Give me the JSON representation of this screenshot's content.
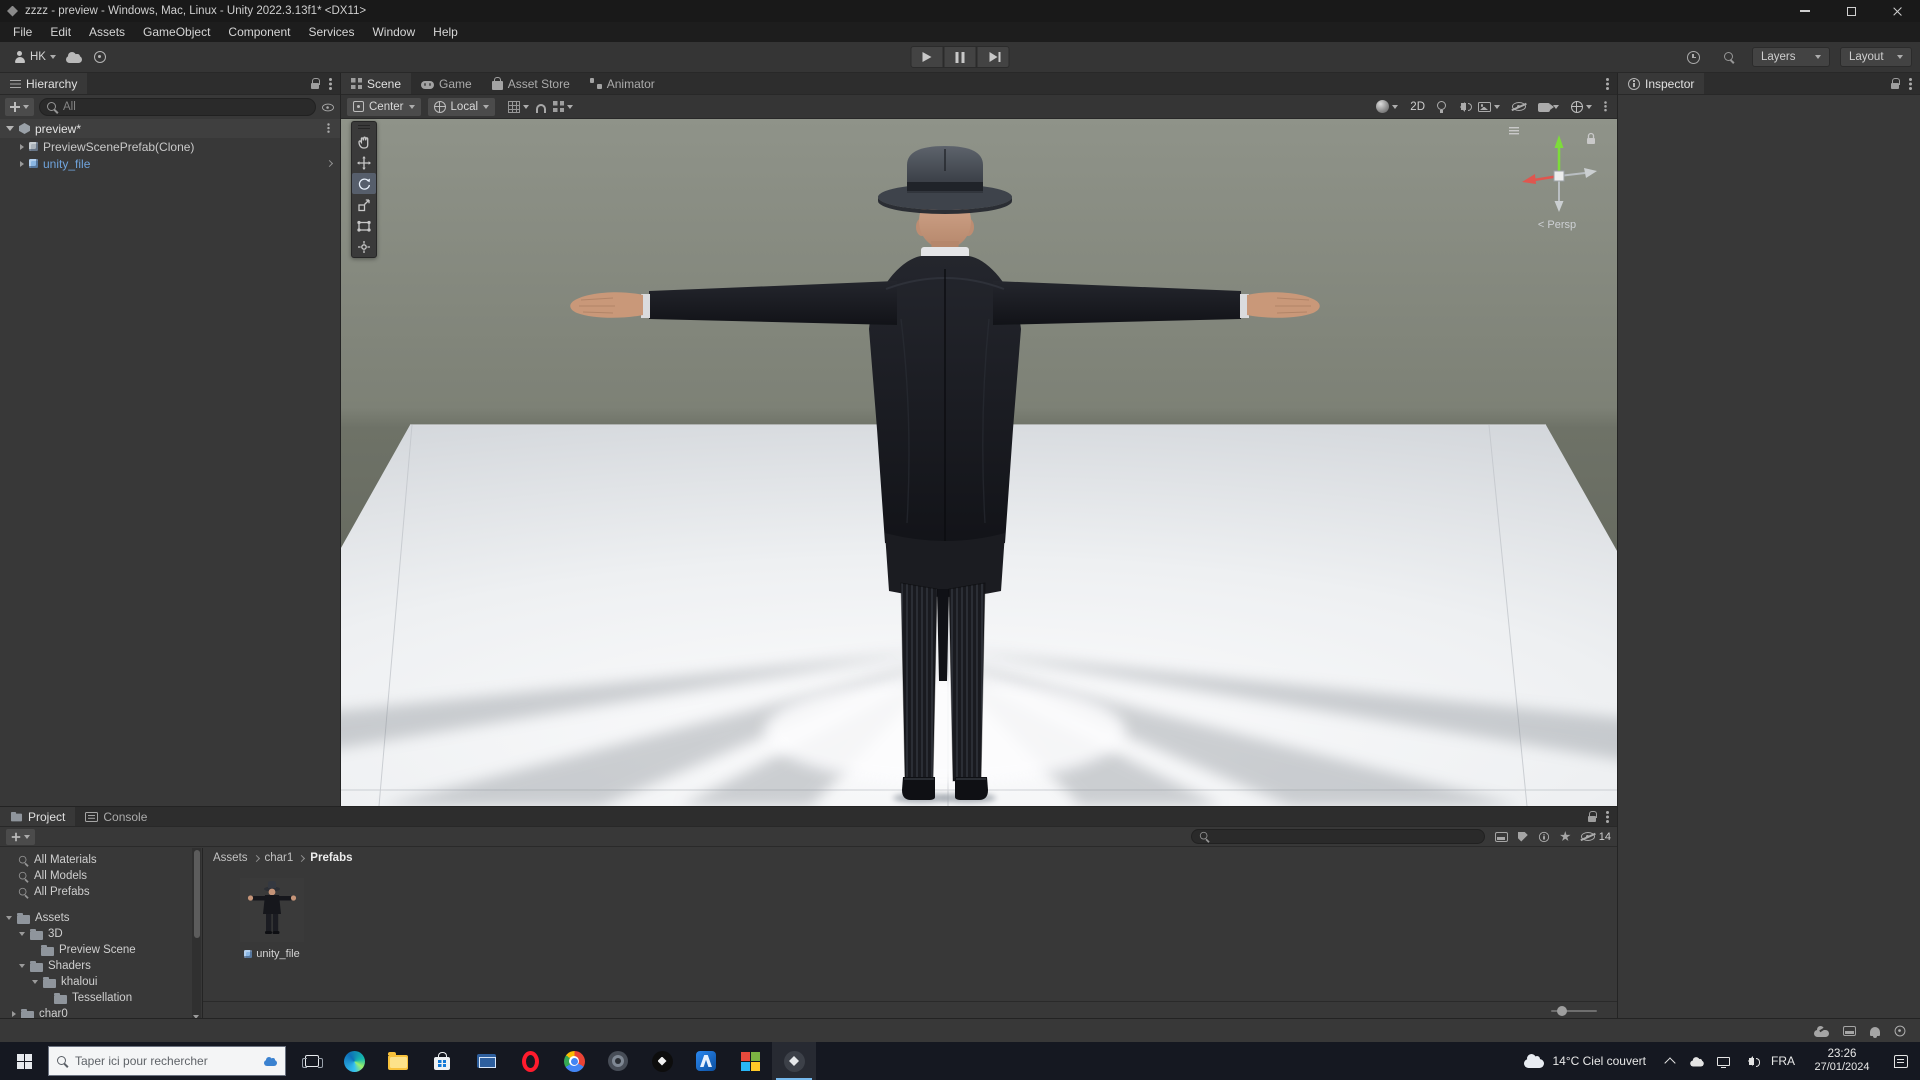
{
  "window": {
    "title": "zzzz - preview - Windows, Mac, Linux - Unity 2022.3.13f1* <DX11>"
  },
  "menu": {
    "items": [
      "File",
      "Edit",
      "Assets",
      "GameObject",
      "Component",
      "Services",
      "Window",
      "Help"
    ]
  },
  "toolbar": {
    "account_label": "HK",
    "layers_label": "Layers",
    "layout_label": "Layout"
  },
  "hierarchy": {
    "title": "Hierarchy",
    "search_placeholder": "All",
    "rows": [
      {
        "label": "preview*",
        "type": "scene",
        "expanded": true
      },
      {
        "label": "PreviewScenePrefab(Clone)",
        "type": "prefab",
        "expanded": false
      },
      {
        "label": "unity_file",
        "type": "prefab",
        "expanded": false,
        "selected": true
      }
    ]
  },
  "scene": {
    "tabs": [
      {
        "label": "Scene",
        "active": true
      },
      {
        "label": "Game",
        "active": false
      },
      {
        "label": "Asset Store",
        "active": false
      },
      {
        "label": "Animator",
        "active": false
      }
    ],
    "pivot_label": "Center",
    "space_label": "Local",
    "d2_label": "2D",
    "persp_label": "< Persp"
  },
  "inspector": {
    "title": "Inspector"
  },
  "project": {
    "tabs": [
      {
        "label": "Project",
        "active": true
      },
      {
        "label": "Console",
        "active": false
      }
    ],
    "favorites": [
      {
        "label": "All Materials"
      },
      {
        "label": "All Models"
      },
      {
        "label": "All Prefabs"
      }
    ],
    "folders": [
      {
        "label": "Assets",
        "indent": 0,
        "expanded": true
      },
      {
        "label": "3D",
        "indent": 1,
        "expanded": true
      },
      {
        "label": "Preview Scene",
        "indent": 2,
        "expanded": null
      },
      {
        "label": "Shaders",
        "indent": 1,
        "expanded": true
      },
      {
        "label": "khaloui",
        "indent": 2,
        "expanded": true
      },
      {
        "label": "Tessellation",
        "indent": 3,
        "expanded": null
      },
      {
        "label": "char0",
        "indent": 1,
        "expanded": false
      }
    ],
    "breadcrumb": {
      "root": "Assets",
      "mid": "char1",
      "leaf": "Prefabs"
    },
    "items": [
      {
        "label": "unity_file",
        "type": "prefab"
      }
    ],
    "hidden_count": "14"
  },
  "taskbar": {
    "search_placeholder": "Taper ici pour rechercher",
    "weather_label": "14°C Ciel couvert",
    "language_label": "FRA",
    "time": "23:26",
    "date": "27/01/2024"
  },
  "colors": {
    "panel_bg": "#383838",
    "strip_bg": "#2D2D2D",
    "prefab_text_blue": "#6FA3DC",
    "active_tool_bg": "#565E6B",
    "taskbar_bg": "#151821",
    "taskbar_underline": "#76B9ED",
    "opera_red": "#FF1B2D"
  }
}
